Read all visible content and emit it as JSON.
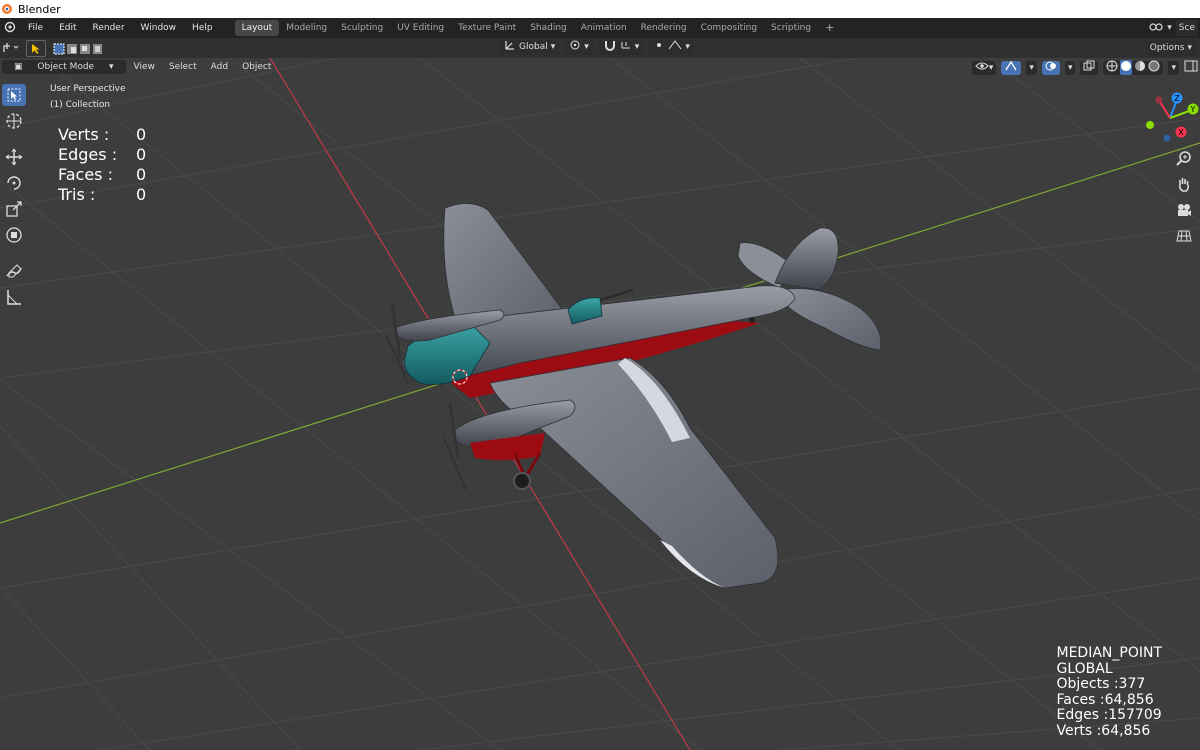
{
  "window": {
    "title": "Blender"
  },
  "menu": [
    "File",
    "Edit",
    "Render",
    "Window",
    "Help"
  ],
  "workspaces": [
    {
      "label": "Layout",
      "active": true
    },
    {
      "label": "Modeling",
      "active": false
    },
    {
      "label": "Sculpting",
      "active": false
    },
    {
      "label": "UV Editing",
      "active": false
    },
    {
      "label": "Texture Paint",
      "active": false
    },
    {
      "label": "Shading",
      "active": false
    },
    {
      "label": "Animation",
      "active": false
    },
    {
      "label": "Rendering",
      "active": false
    },
    {
      "label": "Compositing",
      "active": false
    },
    {
      "label": "Scripting",
      "active": false
    }
  ],
  "add_workspace": "+",
  "scene_label": "Sce",
  "toolheader": {
    "orientation": "Global",
    "options": "Options"
  },
  "viewport_header": {
    "mode": "Object Mode",
    "menus": [
      "View",
      "Select",
      "Add",
      "Object"
    ]
  },
  "overlay": {
    "perspective": "User Perspective",
    "collection": "(1) Collection"
  },
  "stats": [
    {
      "label": "Verts :",
      "value": "0"
    },
    {
      "label": "Edges :",
      "value": "0"
    },
    {
      "label": "Faces :",
      "value": "0"
    },
    {
      "label": "Tris :",
      "value": "0"
    }
  ],
  "bottom_info": [
    "MEDIAN_POINT",
    "GLOBAL",
    "Objects :377",
    "Faces :64,856",
    "Edges :157709",
    "Verts :64,856"
  ],
  "gizmo": {
    "x": "X",
    "y": "Y",
    "z": "Z"
  },
  "colors": {
    "accent": "#4772b3",
    "x_axis": "#ff3352",
    "y_axis": "#8bdc00",
    "z_axis": "#2890ff"
  },
  "tools": [
    "select-box-icon",
    "cursor-icon",
    "move-icon",
    "rotate-icon",
    "scale-icon",
    "transform-icon",
    "annotate-icon",
    "measure-icon"
  ]
}
